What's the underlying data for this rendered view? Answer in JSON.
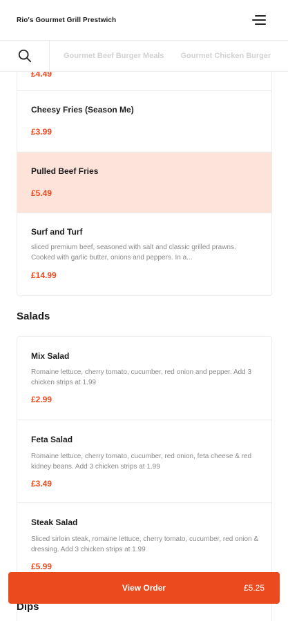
{
  "header": {
    "shop_name": "Rio's Gourmet Grill Prestwich",
    "menu_icon": "hamburger-menu-icon"
  },
  "category_bar": {
    "search_icon": "search-icon",
    "tabs": [
      "Gourmet Beef Burger Meals",
      "Gourmet Chicken Burger"
    ]
  },
  "fries_card": {
    "partial_price": "£4.49",
    "items": [
      {
        "name": "Cheesy Fries (Season Me)",
        "price": "£3.99"
      },
      {
        "name": "Pulled Beef Fries",
        "price": "£5.49"
      },
      {
        "name": "Surf and Turf",
        "description": "sliced premium beef, seasoned with salt and classic grilled prawns. Cooked with garlic butter, onions and peppers. In a...",
        "price": "£14.99"
      }
    ]
  },
  "salads": {
    "title": "Salads",
    "items": [
      {
        "name": "Mix Salad",
        "description": "Romaine lettuce, cherry tomato, cucumber, red onion and pepper. Add 3 chicken strips at 1.99",
        "price": "£2.99"
      },
      {
        "name": "Feta Salad",
        "description": "Romaine lettuce, cherry tomato, cucumber, red onion, feta cheese & red kidney beans. Add 3 chicken strips at 1.99",
        "price": "£3.49"
      },
      {
        "name": "Steak Salad",
        "description": "Sliced sirloin steak, romaine lettuce, cherry tomato, cucumber, red onion & dressing. Add 3 chicken strips at 1.99",
        "price": "£5.99"
      }
    ]
  },
  "dips": {
    "title": "Dips"
  },
  "view_order": {
    "label": "View Order",
    "total": "£5.25"
  },
  "colors": {
    "accent": "#ea4a1e",
    "highlight": "#fde3da"
  }
}
